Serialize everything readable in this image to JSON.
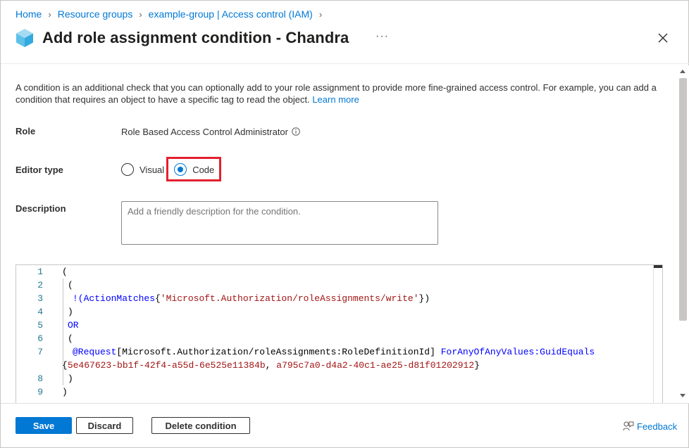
{
  "breadcrumb": {
    "items": [
      "Home",
      "Resource groups",
      "example-group | Access control (IAM)"
    ]
  },
  "header": {
    "title": "Add role assignment condition - Chandra",
    "more_label": "···"
  },
  "intro": {
    "text": "A condition is an additional check that you can optionally add to your role assignment to provide more fine-grained access control. For example, you can add a condition that requires an object to have a specific tag to read the object. ",
    "link": "Learn more"
  },
  "role": {
    "label": "Role",
    "value": "Role Based Access Control Administrator"
  },
  "editor_type": {
    "label": "Editor type",
    "options": [
      "Visual",
      "Code"
    ],
    "selected": "Code"
  },
  "description": {
    "label": "Description",
    "placeholder": "Add a friendly description for the condition."
  },
  "code_lines": [
    "1",
    "2",
    "3",
    "4",
    "5",
    "6",
    "7",
    "",
    "8",
    "9"
  ],
  "code": {
    "l1": "(",
    "l2": "(",
    "l3_bang": "!(",
    "l3_fn": "ActionMatches",
    "l3_open": "{",
    "l3_str": "'Microsoft.Authorization/roleAssignments/write'",
    "l3_close": "})",
    "l4": ")",
    "l5": "OR",
    "l6": "(",
    "l7_attr": "@Request",
    "l7_bracket": "[Microsoft.Authorization/roleAssignments:RoleDefinitionId]",
    "l7_op": "ForAnyOfAnyValues:GuidEquals",
    "l7b_open": "{",
    "l7b_val1": "5e467623-bb1f-42f4-a55d-6e525e11384b",
    "l7b_comma": ", ",
    "l7b_val2": "a795c7a0-d4a2-40c1-ae25-d81f01202912",
    "l7b_close": "}",
    "l8": ")",
    "l9": ")"
  },
  "footer": {
    "save": "Save",
    "discard": "Discard",
    "delete": "Delete condition",
    "feedback": "Feedback"
  },
  "colors": {
    "accent": "#0078d4",
    "highlight": "#e3202e"
  }
}
